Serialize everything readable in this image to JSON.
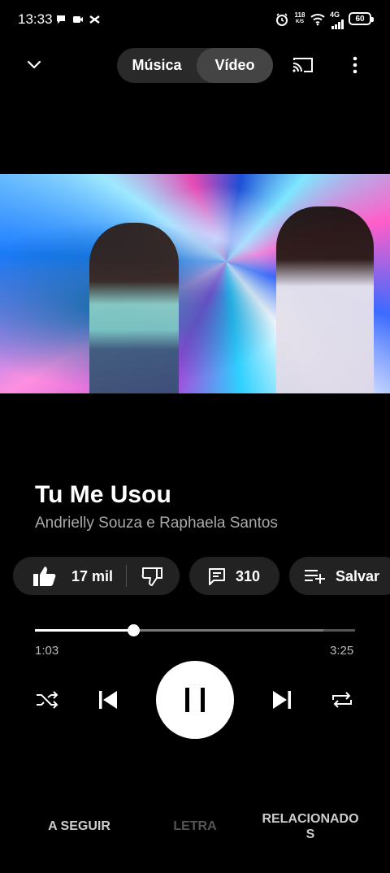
{
  "status_bar": {
    "time": "13:33",
    "net_speed": "118",
    "net_unit": "K/S",
    "net_type": "4G",
    "battery": "60"
  },
  "top_bar": {
    "tab_music": "Música",
    "tab_video": "Vídeo",
    "active_tab": "Vídeo"
  },
  "song": {
    "title": "Tu Me Usou",
    "artist": "Andrielly Souza e Raphaela Santos"
  },
  "actions": {
    "likes": "17 mil",
    "comments": "310",
    "save_label": "Salvar"
  },
  "playback": {
    "current_time": "1:03",
    "duration": "3:25",
    "progress": 0.307,
    "state": "playing"
  },
  "bottom_tabs": {
    "up_next": "A SEGUIR",
    "lyrics": "LETRA",
    "related_line1": "RELACIONADO",
    "related_line2": "S"
  }
}
